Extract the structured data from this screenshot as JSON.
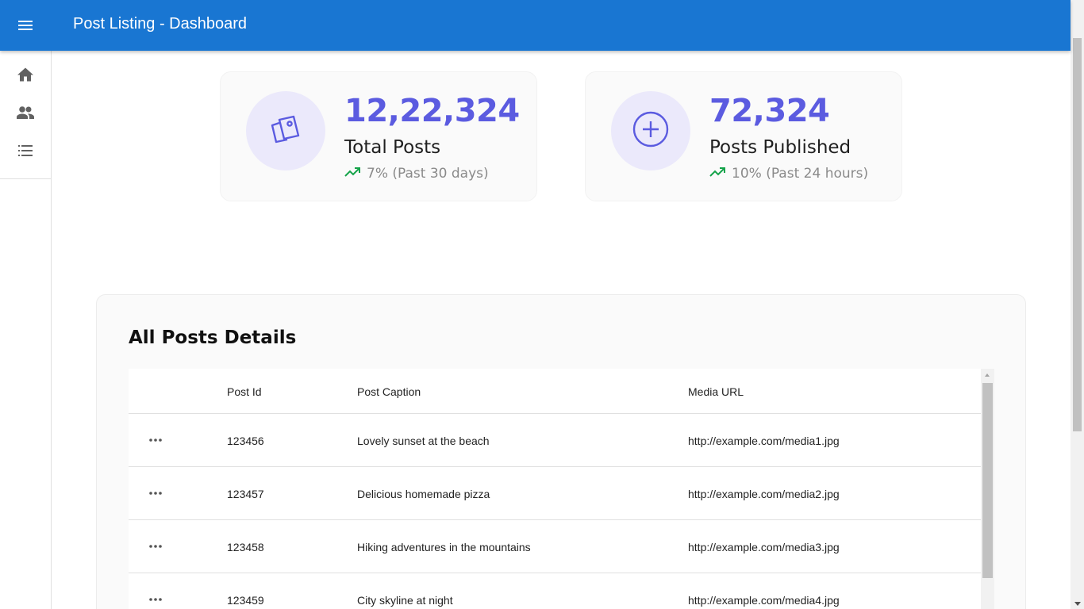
{
  "app": {
    "title": "Post Listing - Dashboard",
    "accent_color": "#1976d2"
  },
  "sidebar": {
    "items": [
      {
        "name": "home",
        "icon": "home-icon"
      },
      {
        "name": "users",
        "icon": "people-icon"
      },
      {
        "name": "list",
        "icon": "list-icon"
      }
    ]
  },
  "stats": [
    {
      "value": "12,22,324",
      "label": "Total Posts",
      "trend": "7% (Past 30 days)",
      "icon": "photos-icon"
    },
    {
      "value": "72,324",
      "label": "Posts Published",
      "trend": "10% (Past 24 hours)",
      "icon": "add-circle-icon"
    }
  ],
  "posts": {
    "title": "All Posts Details",
    "columns": [
      "",
      "Post Id",
      "Post Caption",
      "Media URL"
    ],
    "rows": [
      {
        "id": "123456",
        "caption": "Lovely sunset at the beach",
        "url": "http://example.com/media1.jpg"
      },
      {
        "id": "123457",
        "caption": "Delicious homemade pizza",
        "url": "http://example.com/media2.jpg"
      },
      {
        "id": "123458",
        "caption": "Hiking adventures in the mountains",
        "url": "http://example.com/media3.jpg"
      },
      {
        "id": "123459",
        "caption": "City skyline at night",
        "url": "http://example.com/media4.jpg"
      }
    ]
  }
}
